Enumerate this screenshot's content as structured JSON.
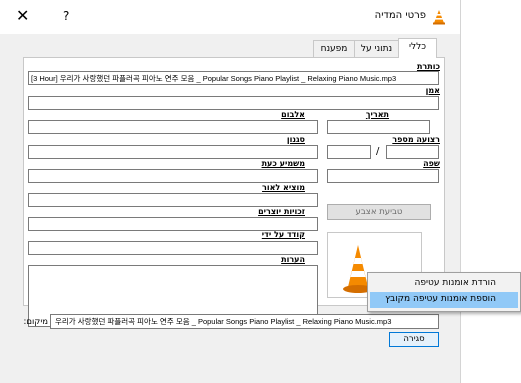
{
  "window": {
    "title": "פרטי המדיה",
    "help_label": "?",
    "close_label": "✕"
  },
  "tabs": [
    {
      "label": "כללי",
      "active": true
    },
    {
      "label": "נתוני על",
      "active": false
    },
    {
      "label": "מפענח",
      "active": false
    }
  ],
  "general": {
    "title_label": "כותרת",
    "title_value": "[3 Hour] 우리가 사랑했던 파플러곡 피아노 연주 모음 _ Popular Songs Piano Playlist _ Relaxing Piano Music.mp3",
    "artist_label": "אמן",
    "artist_value": "",
    "album_label": "אלבום",
    "album_value": "",
    "date_label": "תאריך",
    "date_value": "",
    "genre_label": "סגנון",
    "genre_value": "",
    "track_number_label": "רצועה מספר",
    "track_number_value": "",
    "track_total_value": "",
    "track_separator": "/",
    "now_playing_label": "משמיע כעת",
    "now_playing_value": "",
    "language_label": "שפה",
    "language_value": "",
    "publisher_label": "מוציא לאור",
    "publisher_value": "",
    "copyright_label": "זכויות יוצרים",
    "copyright_value": "",
    "fingerprint_button": "טביעת אצבע",
    "encoded_by_label": "קודד על ידי",
    "encoded_by_value": "",
    "comments_label": "הערות",
    "comments_value": ""
  },
  "context_menu": {
    "items": [
      {
        "label": "הורדת אומנות עטיפה",
        "highlighted": false
      },
      {
        "label": "הוספת אומנות עטיפה מקובץ",
        "highlighted": true
      }
    ]
  },
  "footer": {
    "location_label": "מיקום:",
    "location_value": "우리가 사랑했던 파플러곡 피아노 연주 모음 _ Popular Songs Piano Playlist _ Relaxing Piano Music.mp3",
    "close_button": "סגירה"
  },
  "colors": {
    "dialog_bg": "#f0f0f0",
    "menu_highlight": "#91c9f7",
    "vlc_orange": "#f58a00"
  },
  "icons": {
    "app_icon": "vlc-cone-icon",
    "cover_art": "vlc-cone-icon"
  }
}
